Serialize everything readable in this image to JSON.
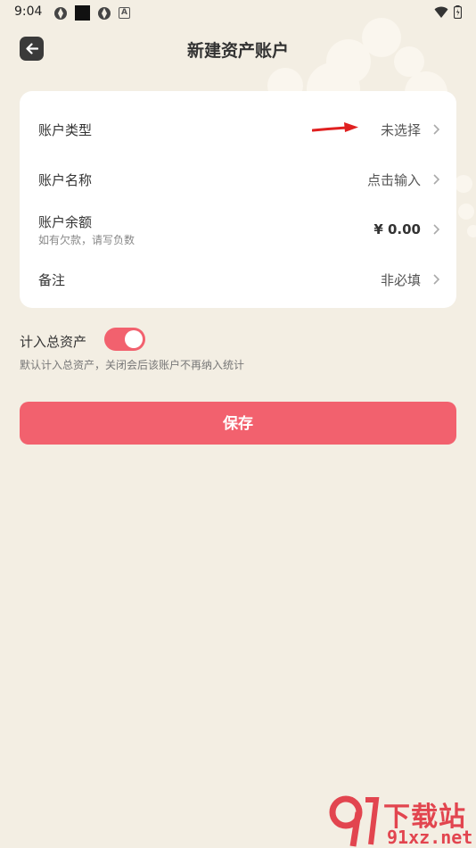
{
  "status_bar": {
    "time": "9:04",
    "notification_letter": "A"
  },
  "header": {
    "title": "新建资产账户"
  },
  "form": {
    "rows": [
      {
        "label": "账户类型",
        "value": "未选择"
      },
      {
        "label": "账户名称",
        "value": "点击输入"
      },
      {
        "label": "账户余额",
        "sublabel": "如有欠款，请写负数",
        "value": "¥ 0.00"
      },
      {
        "label": "备注",
        "value": "非必填"
      }
    ]
  },
  "include_total": {
    "label": "计入总资产",
    "hint": "默认计入总资产，关闭会后该账户不再纳入统计",
    "enabled": true
  },
  "actions": {
    "save_label": "保存"
  },
  "watermark": {
    "top": "下载站",
    "bottom": "91xz.net"
  },
  "colors": {
    "accent": "#f2616e",
    "background": "#f3eee3",
    "card": "#ffffff",
    "watermark": "#e2454f"
  }
}
